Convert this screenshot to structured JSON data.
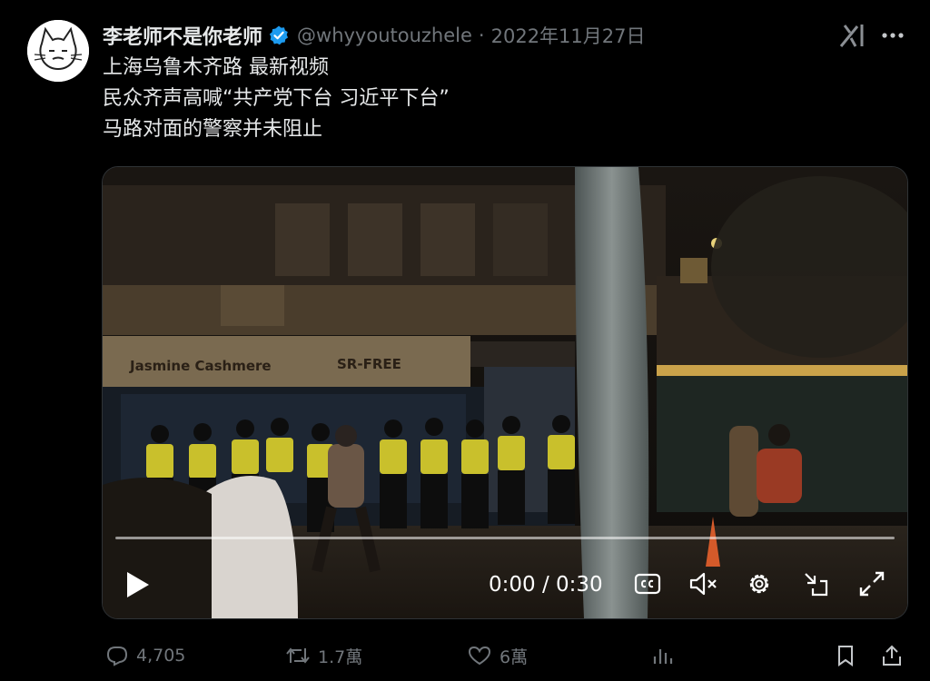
{
  "author": {
    "display_name": "李老师不是你老师",
    "handle": "@whyyoutouzhele",
    "separator": "·",
    "date": "2022年11月27日",
    "verified_color": "#1d9bf0"
  },
  "tweet": {
    "lines": [
      "上海乌鲁木齐路 最新视频",
      "民众齐声高喊“共产党下台 习近平下台”",
      "马路对面的警察并未阻止"
    ]
  },
  "video": {
    "storefront_sign_left": "Jasmine Cashmere",
    "storefront_sign_right": "SR-FREE",
    "time_display": "0:00 / 0:30",
    "progress": 0,
    "accent": "#1d9bf0"
  },
  "actions": {
    "replies": "4,705",
    "reposts": "1.7萬",
    "likes": "6萬"
  },
  "icons": {
    "verified": "verified-badge-icon",
    "grok": "grok-icon",
    "more": "more-icon",
    "play": "play-icon",
    "captions": "captions-icon",
    "mute": "mute-icon",
    "settings": "gear-icon",
    "pip": "pip-icon",
    "fullscreen": "fullscreen-icon",
    "reply": "reply-icon",
    "repost": "repost-icon",
    "like": "heart-icon",
    "views": "analytics-icon",
    "bookmark": "bookmark-icon",
    "share": "share-icon"
  }
}
